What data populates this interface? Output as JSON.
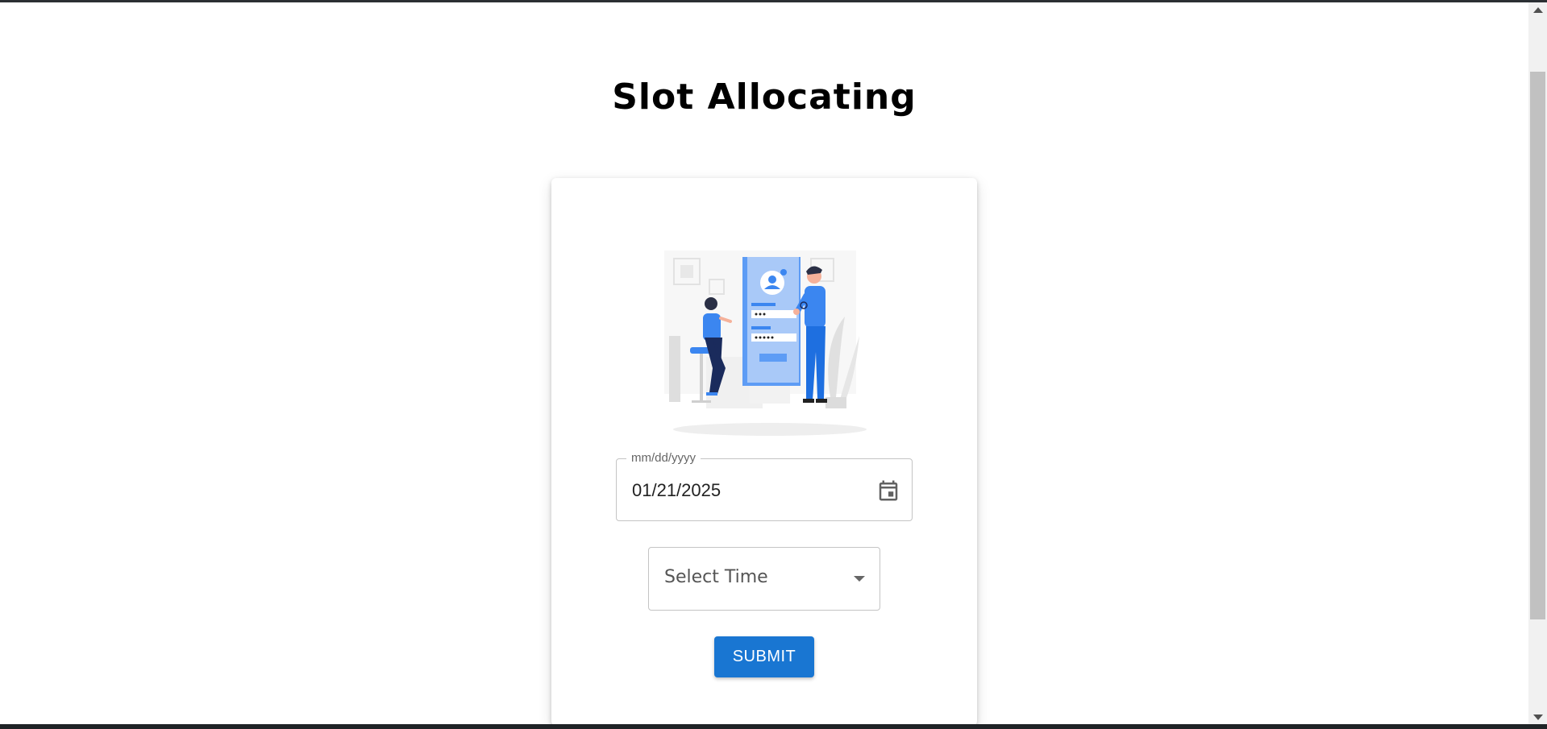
{
  "page": {
    "title": "Slot Allocating"
  },
  "form": {
    "date_label": "mm/dd/yyyy",
    "date_value": "01/21/2025",
    "time_placeholder": "Select Time",
    "submit_label": "SUBMIT"
  },
  "icons": {
    "calendar": "calendar-icon",
    "caret": "chevron-down-icon",
    "scroll_up": "scroll-up-arrow",
    "scroll_down": "scroll-down-arrow"
  },
  "colors": {
    "primary": "#1976d2",
    "illustration_blue": "#3b86f0"
  }
}
